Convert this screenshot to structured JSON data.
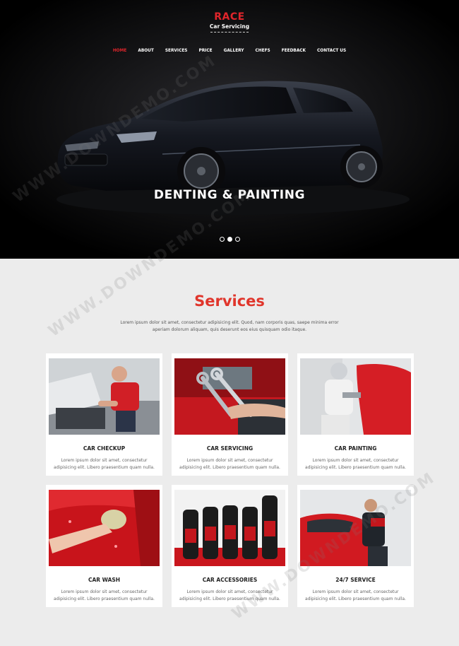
{
  "brand": {
    "name": "RACE",
    "subtitle": "Car Servicing"
  },
  "nav": {
    "items": [
      {
        "label": "HOME",
        "active": true
      },
      {
        "label": "ABOUT"
      },
      {
        "label": "SERVICES"
      },
      {
        "label": "PRICE"
      },
      {
        "label": "GALLERY"
      },
      {
        "label": "CHEFS"
      },
      {
        "label": "FEEDBACK"
      },
      {
        "label": "CONTACT US"
      }
    ]
  },
  "hero": {
    "caption": "DENTING & PAINTING",
    "slide_count": 3,
    "active_slide": 2
  },
  "services": {
    "title": "Services",
    "description": "Lorem ipsum dolor sit amet, consectetur adipisicing elit. Quod, nam corporis quas, saepe minima error aperiam dolorum aliquam, quis deserunt eos eius quisquam odio itaque.",
    "cards": [
      {
        "title": "CAR CHECKUP",
        "text": "Lorem ipsum dolor sit amet, consectetur adipisicing elit. Libero praesentium quam nulla."
      },
      {
        "title": "CAR SERVICING",
        "text": "Lorem ipsum dolor sit amet, consectetur adipisicing elit. Libero praesentium quam nulla."
      },
      {
        "title": "CAR PAINTING",
        "text": "Lorem ipsum dolor sit amet, consectetur adipisicing elit. Libero praesentium quam nulla."
      },
      {
        "title": "CAR WASH",
        "text": "Lorem ipsum dolor sit amet, consectetur adipisicing elit. Libero praesentium quam nulla."
      },
      {
        "title": "CAR ACCESSORIES",
        "text": "Lorem ipsum dolor sit amet, consectetur adipisicing elit. Libero praesentium quam nulla."
      },
      {
        "title": "24/7 SERVICE",
        "text": "Lorem ipsum dolor sit amet, consectetur adipisicing elit. Libero praesentium quam nulla."
      }
    ]
  },
  "watermark": "WWW.DOWNDEMO.COM",
  "colors": {
    "accent": "#e0252b",
    "hero_bg": "#000000",
    "page_bg": "#ececec",
    "card_bg": "#ffffff"
  }
}
